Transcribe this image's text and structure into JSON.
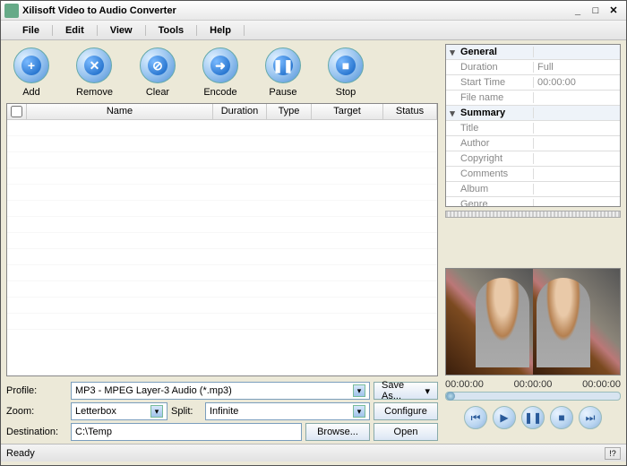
{
  "window": {
    "title": "Xilisoft Video to Audio Converter"
  },
  "menu": [
    "File",
    "Edit",
    "View",
    "Tools",
    "Help"
  ],
  "toolbar": [
    {
      "label": "Add",
      "glyph": "+"
    },
    {
      "label": "Remove",
      "glyph": "✕"
    },
    {
      "label": "Clear",
      "glyph": "⊘"
    },
    {
      "label": "Encode",
      "glyph": "➜"
    },
    {
      "label": "Pause",
      "glyph": "❚❚"
    },
    {
      "label": "Stop",
      "glyph": "■"
    }
  ],
  "columns": {
    "check": "",
    "name": "Name",
    "duration": "Duration",
    "type": "Type",
    "target": "Target",
    "status": "Status"
  },
  "profile": {
    "label": "Profile:",
    "value": "MP3 - MPEG Layer-3 Audio  (*.mp3)",
    "saveas": "Save As..."
  },
  "zoom": {
    "label": "Zoom:",
    "value": "Letterbox"
  },
  "split": {
    "label": "Split:",
    "value": "Infinite"
  },
  "configure": "Configure",
  "dest": {
    "label": "Destination:",
    "value": "C:\\Temp",
    "browse": "Browse...",
    "open": "Open"
  },
  "props": {
    "general": "General",
    "rows_general": [
      [
        "Duration",
        "Full"
      ],
      [
        "Start Time",
        "00:00:00"
      ],
      [
        "File name",
        ""
      ]
    ],
    "summary": "Summary",
    "rows_summary": [
      [
        "Title",
        ""
      ],
      [
        "Author",
        ""
      ],
      [
        "Copyright",
        ""
      ],
      [
        "Comments",
        ""
      ],
      [
        "Album",
        ""
      ],
      [
        "Genre",
        ""
      ]
    ]
  },
  "time": [
    "00:00:00",
    "00:00:00",
    "00:00:00"
  ],
  "status": "Ready",
  "excl": "!?"
}
